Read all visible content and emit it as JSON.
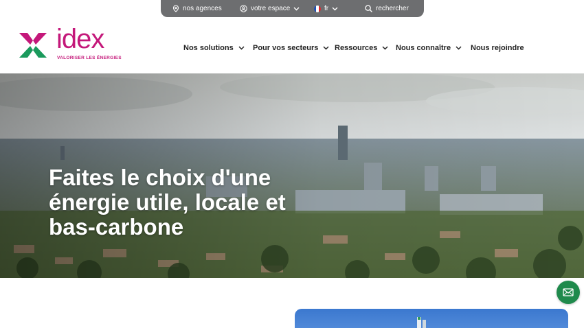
{
  "topbar": {
    "agencies": "nos agences",
    "account": "votre espace",
    "language": "fr",
    "search": "rechercher"
  },
  "brand": {
    "name": "idex",
    "tagline": "VALORISER LES ÉNERGIES",
    "color": "#c4187a",
    "accent_green": "#1f8a4c"
  },
  "nav": {
    "items": [
      {
        "label": "Nos solutions",
        "has_dropdown": true
      },
      {
        "label": "Pour vos secteurs",
        "has_dropdown": true
      },
      {
        "label": "Ressources",
        "has_dropdown": true
      },
      {
        "label": "Nous connaître",
        "has_dropdown": true
      },
      {
        "label": "Nous rejoindre",
        "has_dropdown": false
      }
    ]
  },
  "hero": {
    "title": "Faites le choix d'une énergie utile, locale et bas-carbone"
  },
  "contact": {
    "icon": "mail-icon"
  }
}
